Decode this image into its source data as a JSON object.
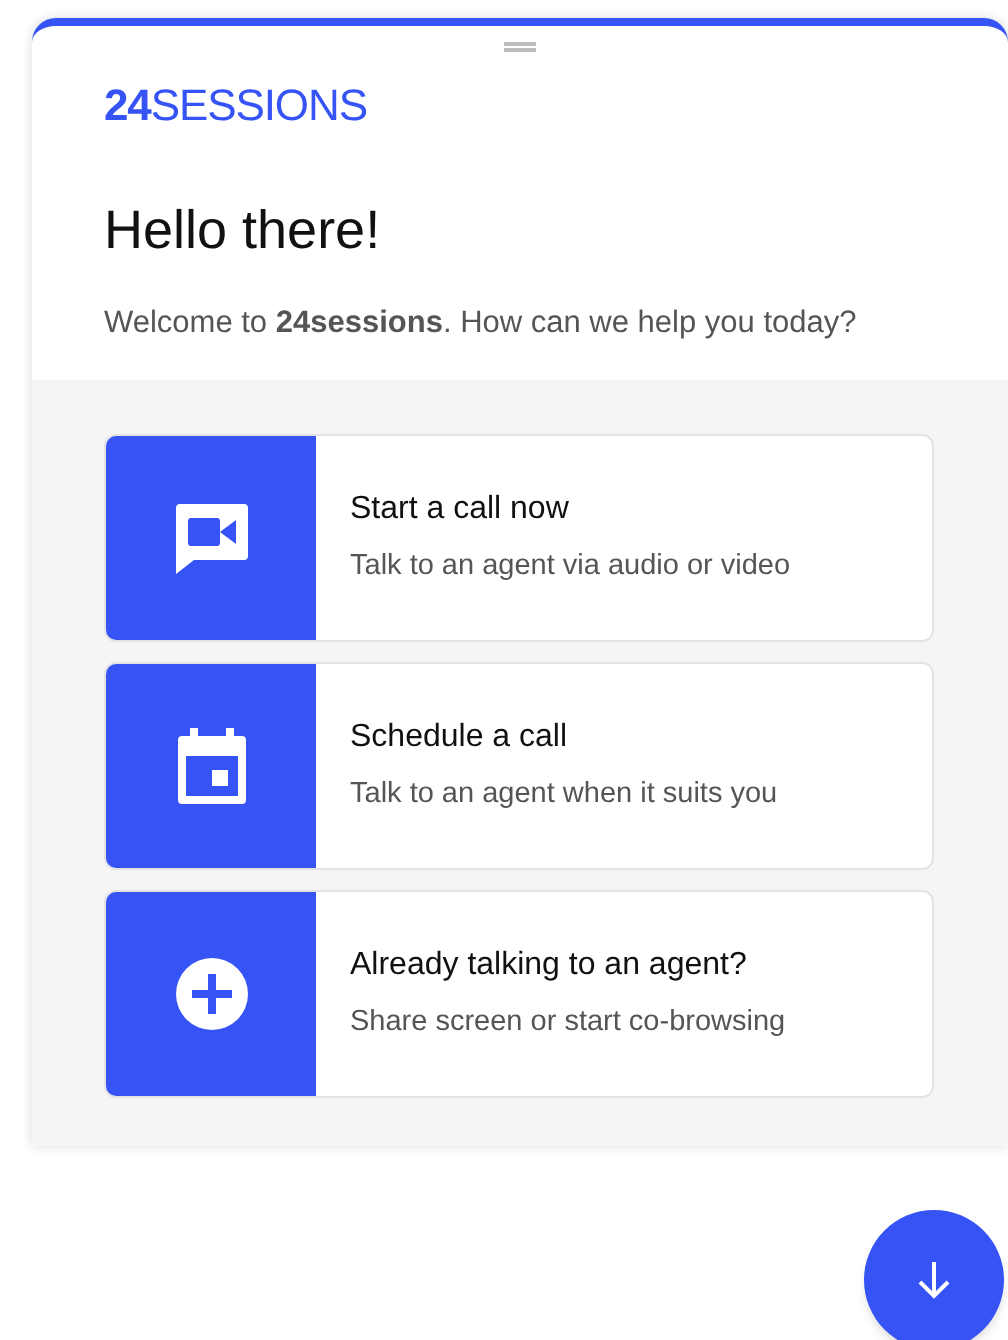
{
  "logo": "**24**SESSIONS",
  "heading": "Hello there!",
  "welcome": "Welcome to **24sessions**. How can we help you today?",
  "options": [
    {
      "kind": "video",
      "title": "Start a call now",
      "subtitle": "Talk to an agent via audio or video"
    },
    {
      "kind": "calendar",
      "title": "Schedule a call",
      "subtitle": "Talk to an agent when it suits you"
    },
    {
      "kind": "plus",
      "title": "Already talking to an agent?",
      "subtitle": "Share screen or start co-browsing"
    }
  ]
}
